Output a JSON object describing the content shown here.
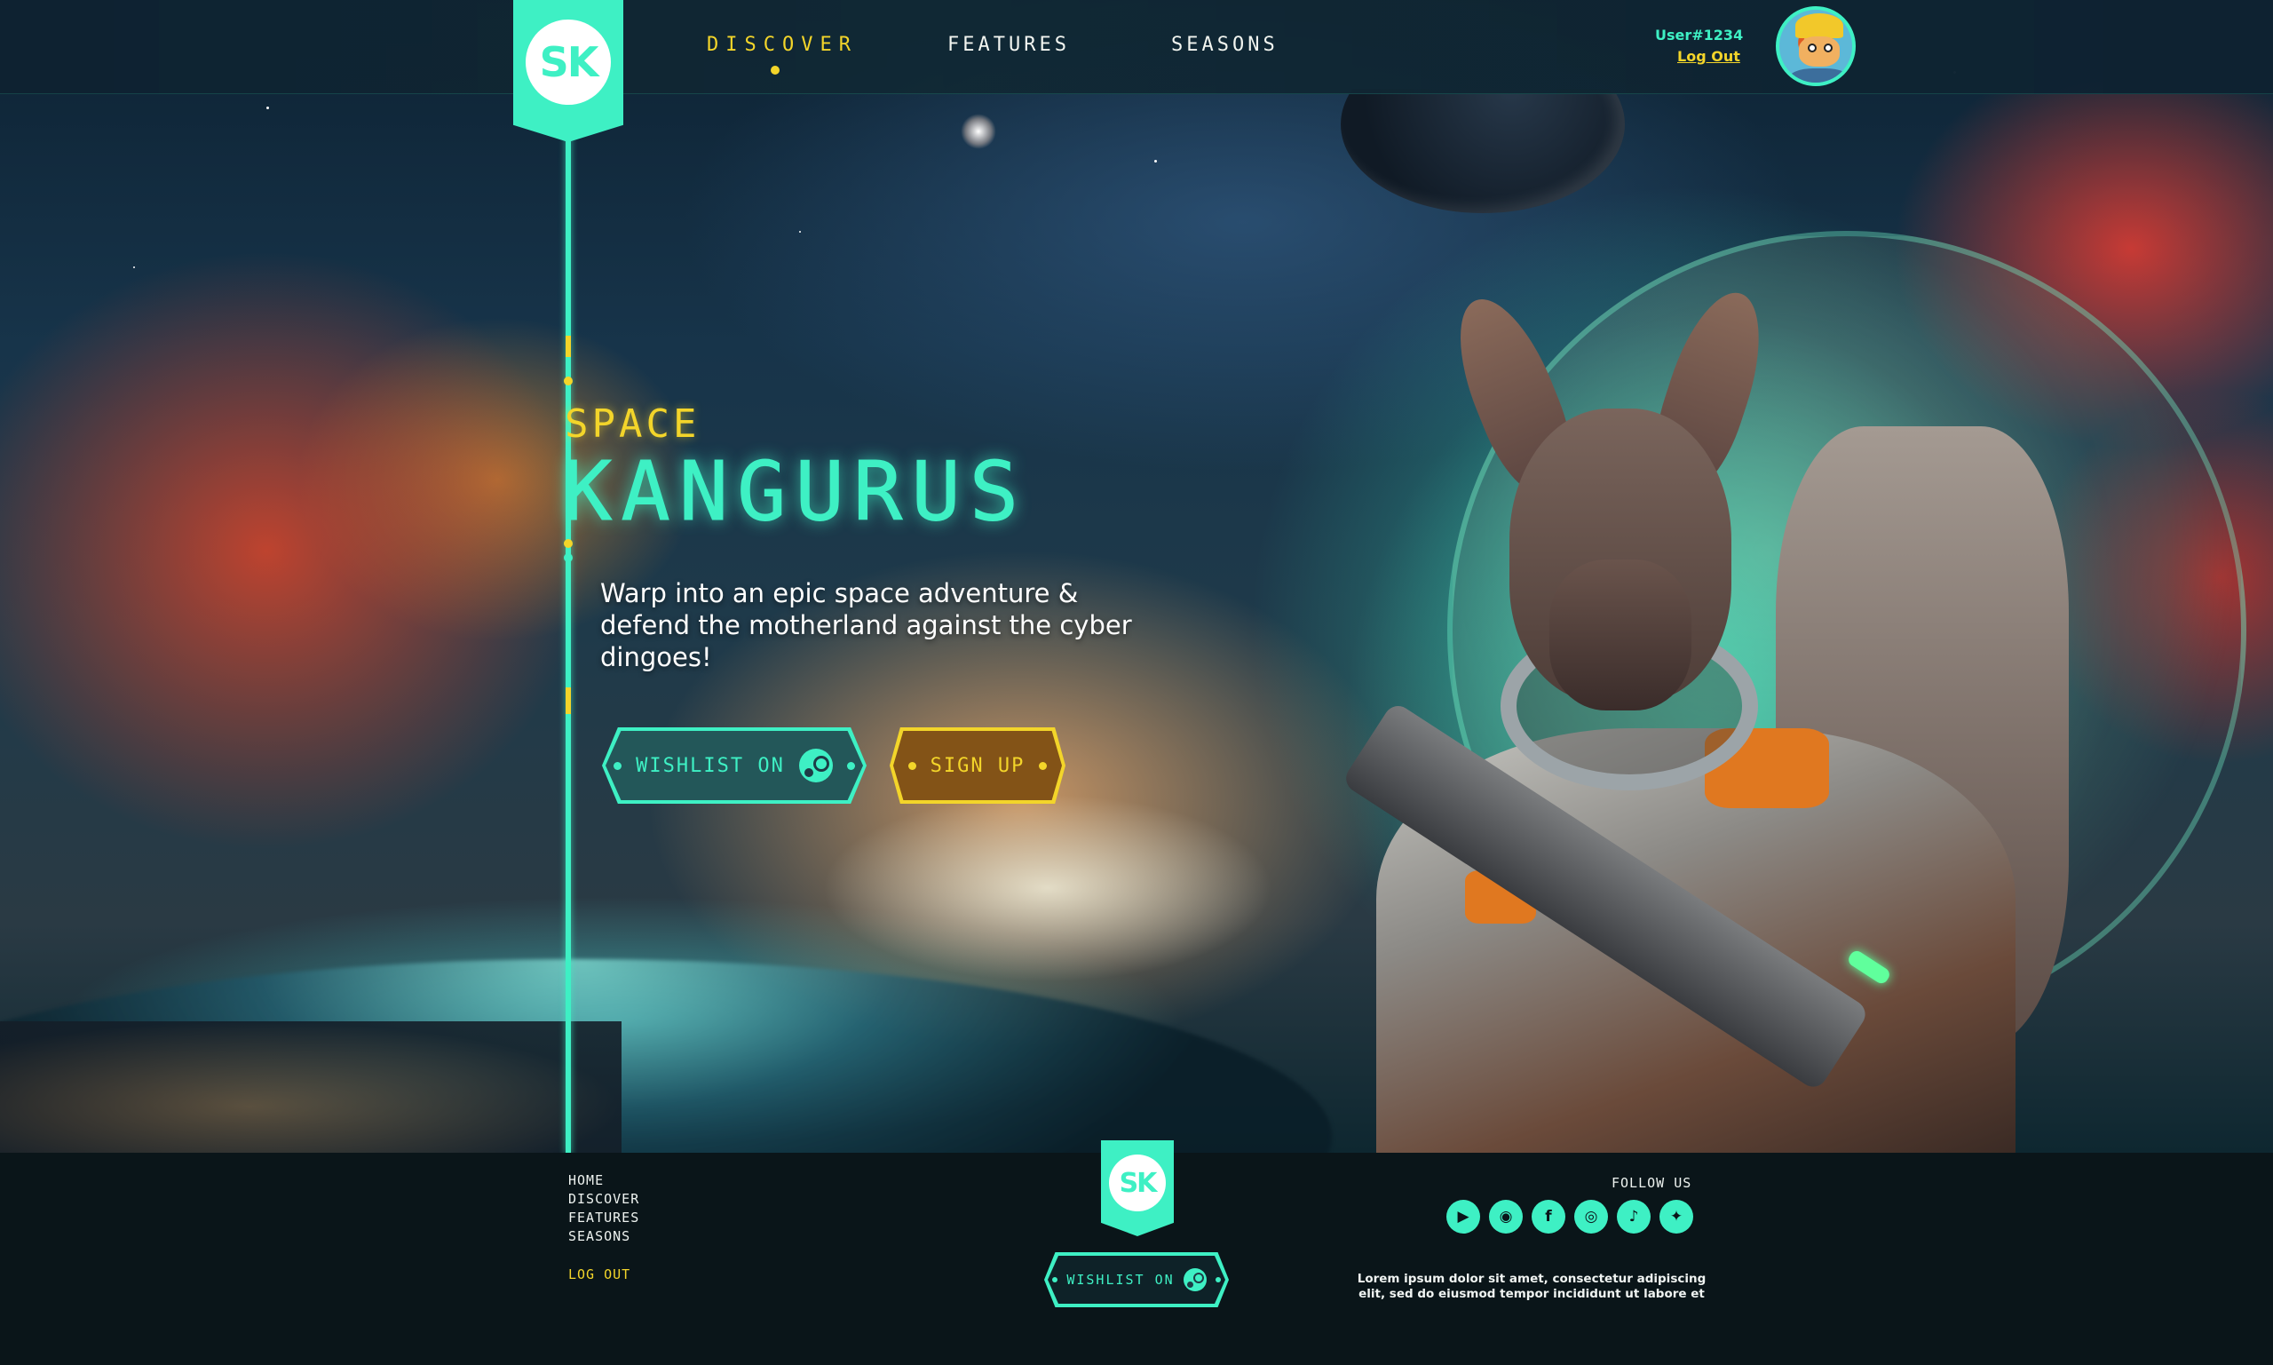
{
  "nav": {
    "logo_text": "SK",
    "links": [
      "DISCOVER",
      "FEATURES",
      "SEASONS"
    ],
    "active_link": "DISCOVER",
    "user_name": "User#1234",
    "logout_label": "Log Out"
  },
  "hero": {
    "title_small": "SPACE",
    "title_main": "KANGURUS",
    "tagline": "Warp into an epic space adventure & defend the motherland against the cyber dingoes!",
    "wishlist_label": "WISHLIST ON",
    "signup_label": "SIGN UP",
    "wishlist_icon": "steam-icon"
  },
  "footer": {
    "links": [
      "HOME",
      "DISCOVER",
      "FEATURES",
      "SEASONS"
    ],
    "logout_label": "LOG OUT",
    "logo_text": "SK",
    "wishlist_label": "WISHLIST ON",
    "follow_label": "FOLLOW US",
    "socials": [
      "youtube-icon",
      "discord-icon",
      "facebook-icon",
      "instagram-icon",
      "tiktok-icon",
      "twitter-icon"
    ],
    "lorem_line1": "Lorem ipsum dolor sit amet, consectetur adipiscing",
    "lorem_line2": "elit, sed do eiusmod tempor incididunt ut labore et"
  },
  "colors": {
    "accent_teal": "#3ef0c4",
    "accent_yellow": "#f3d52a",
    "background_dark": "#0a1519"
  }
}
